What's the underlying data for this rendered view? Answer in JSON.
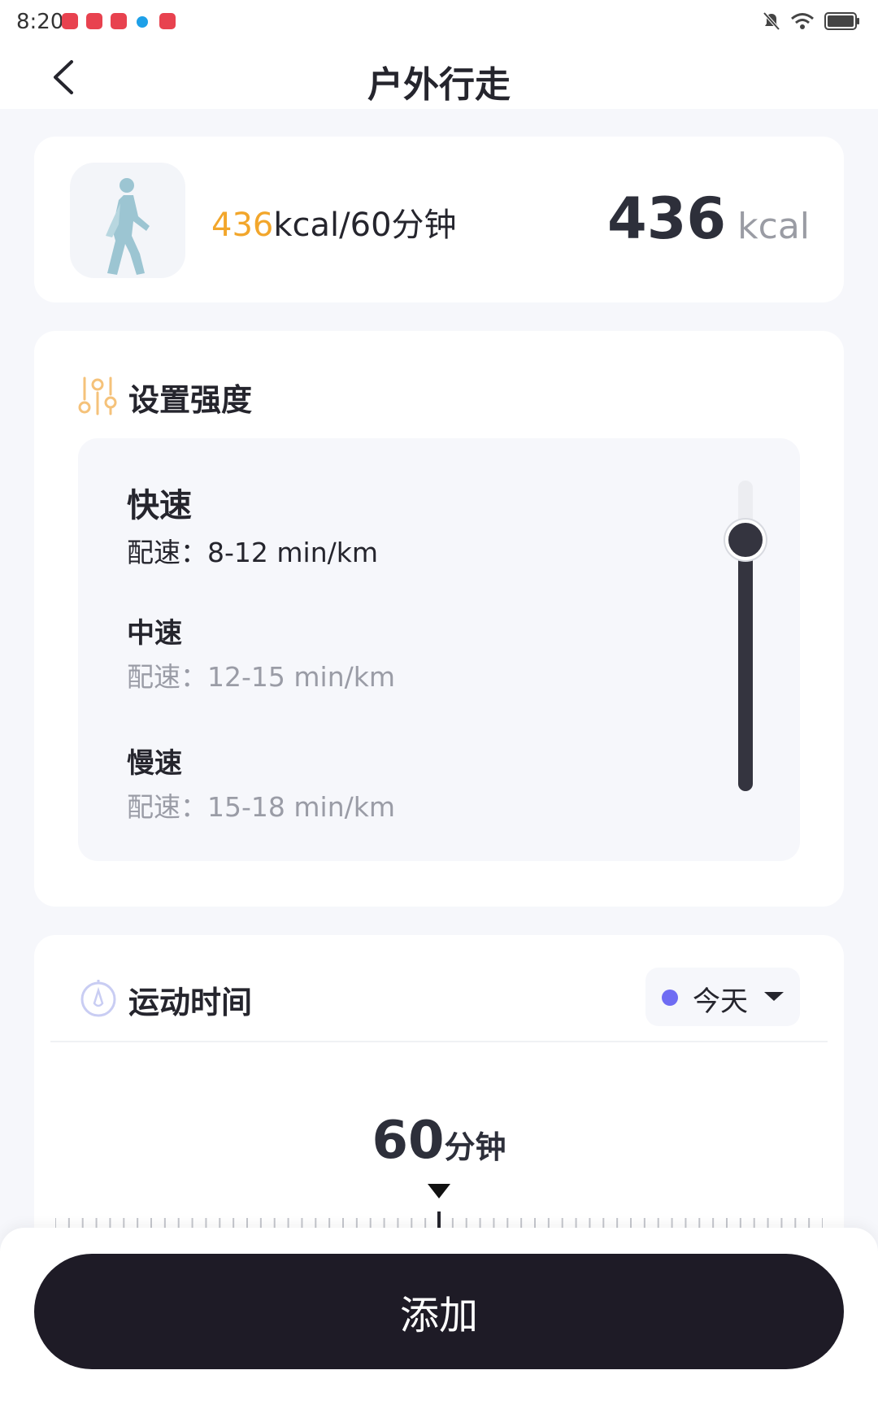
{
  "status_bar": {
    "time": "8:20"
  },
  "header": {
    "title": "户外行走",
    "back_icon": "chevron-left-icon"
  },
  "calorie_card": {
    "activity_icon": "walking-person-icon",
    "rate_value": "436",
    "rate_unit": "kcal/60分钟",
    "total_value": "436",
    "total_unit": "kcal"
  },
  "intensity": {
    "title": "设置强度",
    "icon": "sliders-icon",
    "levels": [
      {
        "name": "快速",
        "pace": "配速：8-12 min/km"
      },
      {
        "name": "中速",
        "pace": "配速：12-15 min/km"
      },
      {
        "name": "慢速",
        "pace": "配速：15-18 min/km"
      }
    ],
    "selected": "快速"
  },
  "exercise_time": {
    "title": "运动时间",
    "icon": "stopwatch-icon",
    "date_label": "今天",
    "duration_value": "60",
    "duration_unit": "分钟"
  },
  "colors": {
    "accent_orange": "#f2a62b",
    "dark": "#1e1b26",
    "date_dot": "#6f6cf3"
  },
  "footer": {
    "add_label": "添加"
  }
}
